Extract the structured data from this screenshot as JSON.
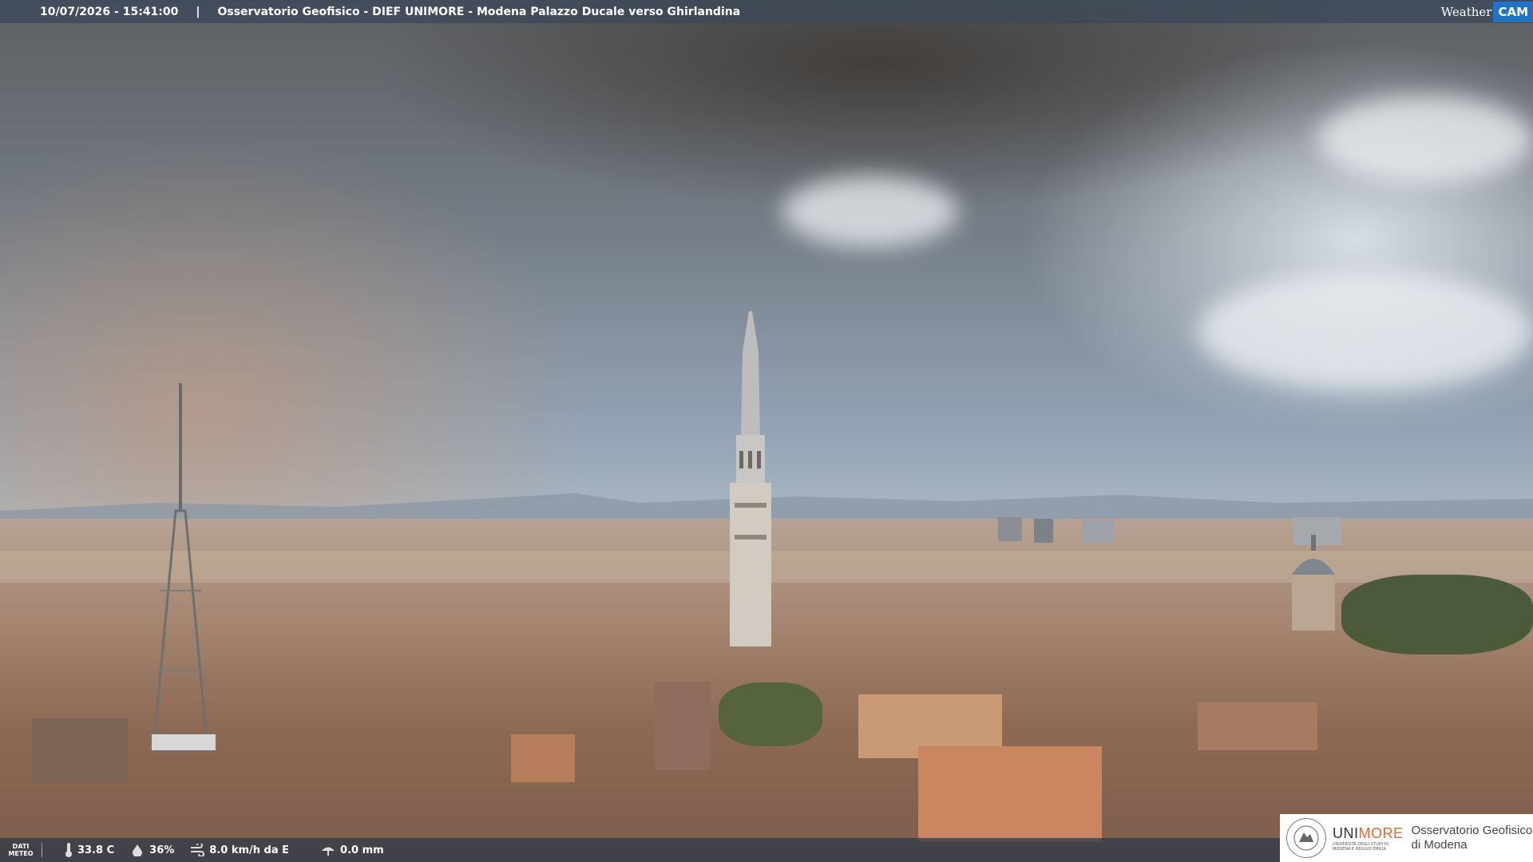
{
  "header": {
    "datetime": "10/07/2026 - 15:41:00",
    "separator": "|",
    "title": "Osservatorio Geofisico - DIEF UNIMORE - Modena Palazzo Ducale verso Ghirlandina"
  },
  "brand": {
    "weather": "Weather",
    "cam": "CAM"
  },
  "weather_bar": {
    "label_line1": "DATI",
    "label_line2": "METEO",
    "temperature": "33.8 C",
    "humidity": "36%",
    "wind": "8.0 km/h da E",
    "rain": "0.0 mm"
  },
  "logo": {
    "uni_prefix": "UNI",
    "uni_suffix": "MORE",
    "uni_sub1": "UNIVERSITÀ DEGLI STUDI DI",
    "uni_sub2": "MODENA E REGGIO EMILIA",
    "obs_line1": "Osservatorio Geofisico",
    "obs_line2": "di Modena"
  }
}
